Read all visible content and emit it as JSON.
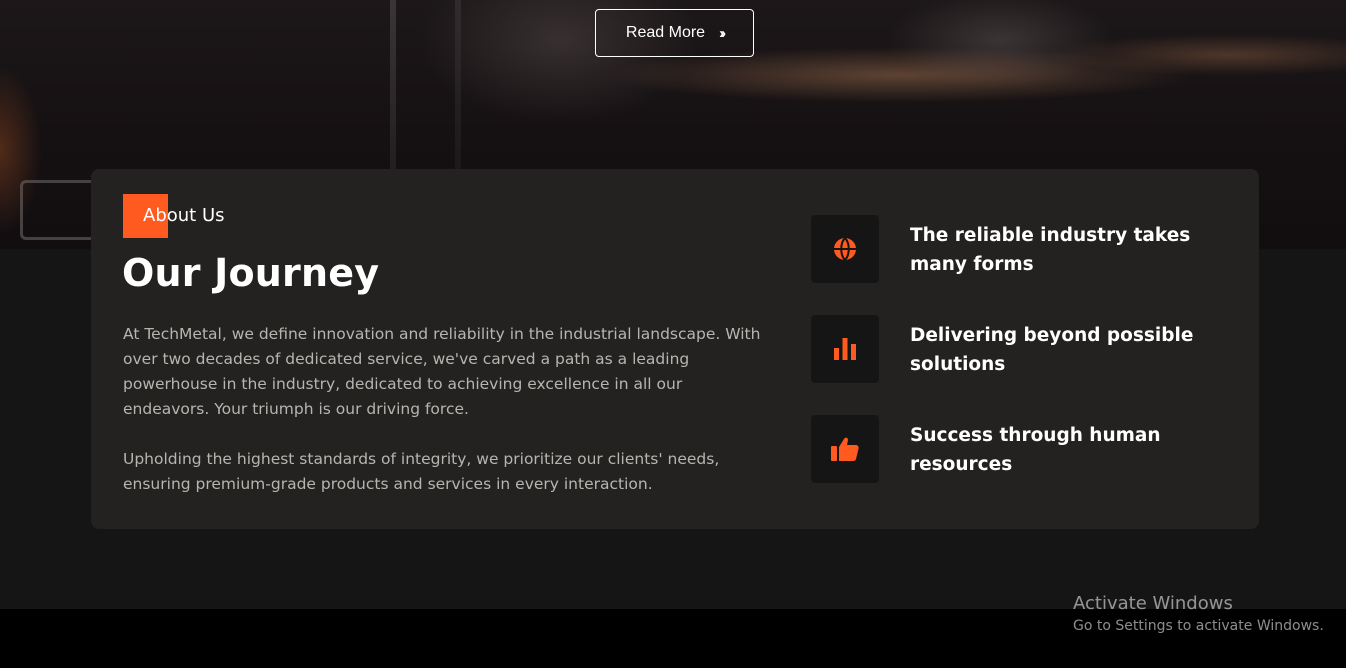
{
  "hero": {
    "read_more_label": "Read More",
    "read_more_icon": "double-chevron-right-icon"
  },
  "about": {
    "badge_label": "About Us",
    "title": "Our Journey",
    "paragraphs": [
      "At TechMetal, we define innovation and reliability in the industrial landscape. With over two decades of dedicated service, we've carved a path as a leading powerhouse in the industry, dedicated to achieving excellence in all our endeavors. Your triumph is our driving force.",
      "Upholding the highest standards of integrity, we prioritize our clients' needs, ensuring premium-grade products and services in every interaction."
    ],
    "features": [
      {
        "icon": "globe-icon",
        "text": "The reliable industry takes many forms"
      },
      {
        "icon": "bar-chart-icon",
        "text": "Delivering beyond possible solutions"
      },
      {
        "icon": "thumbs-up-icon",
        "text": "Success through human resources"
      }
    ]
  },
  "watermark": {
    "title": "Activate Windows",
    "subtitle": "Go to Settings to activate Windows."
  },
  "colors": {
    "accent": "#ff5a1f",
    "card_bg": "#232221",
    "page_bg": "#151515",
    "icon_box_bg": "#151515"
  }
}
